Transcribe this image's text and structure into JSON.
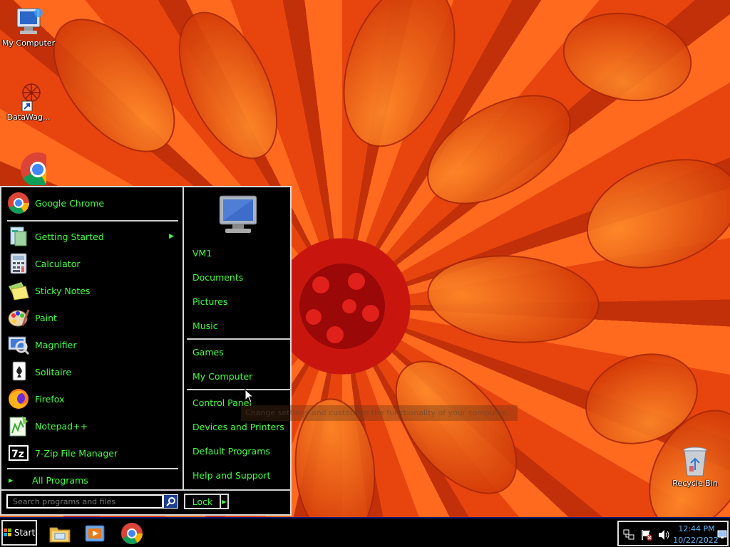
{
  "desktop": {
    "icons": [
      {
        "label": "My Computer"
      },
      {
        "label": "DataWag..."
      },
      {
        "label": ""
      },
      {
        "label": "Recycle Bin"
      }
    ]
  },
  "start_menu": {
    "pinned": [
      {
        "label": "Google Chrome",
        "icon": "chrome-icon"
      }
    ],
    "recent": [
      {
        "label": "Getting Started",
        "icon": "getting-started-icon",
        "has_submenu": true
      },
      {
        "label": "Calculator",
        "icon": "calculator-icon"
      },
      {
        "label": "Sticky Notes",
        "icon": "sticky-notes-icon"
      },
      {
        "label": "Paint",
        "icon": "paint-icon"
      },
      {
        "label": "Magnifier",
        "icon": "magnifier-icon"
      },
      {
        "label": "Solitaire",
        "icon": "solitaire-icon"
      },
      {
        "label": "Firefox",
        "icon": "firefox-icon"
      },
      {
        "label": "Notepad++",
        "icon": "notepad-plus-plus-icon"
      },
      {
        "label": "7-Zip File Manager",
        "icon": "seven-zip-icon"
      }
    ],
    "all_programs": "All Programs",
    "right_links_1": [
      "VM1",
      "Documents",
      "Pictures",
      "Music"
    ],
    "right_links_2": [
      "Games",
      "My Computer"
    ],
    "right_links_3": [
      "Control Panel",
      "Devices and Printers",
      "Default Programs",
      "Help and Support"
    ],
    "search_placeholder": "Search programs and files",
    "lock_label": "Lock",
    "tooltip": "Change settings and customize the functionality of your computer."
  },
  "taskbar": {
    "start_label": "Start",
    "apps": [
      {
        "name": "file-explorer-icon"
      },
      {
        "name": "media-player-icon"
      },
      {
        "name": "chrome-icon"
      }
    ],
    "clock": {
      "time": "12:44 PM",
      "date": "10/22/2022"
    }
  },
  "colors": {
    "menu_text": "#3dff3d",
    "menu_bg": "#000000",
    "wallpaper": "#e34a10",
    "clock_text": "#5ab8ff"
  }
}
